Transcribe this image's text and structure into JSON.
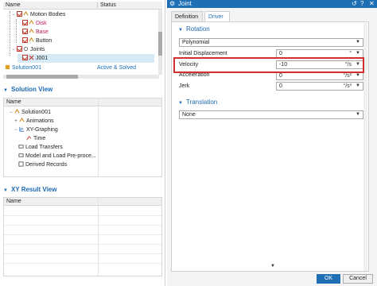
{
  "navigator": {
    "col_name": "Name",
    "col_status": "Status",
    "items": [
      {
        "label": "Motion Bodies"
      },
      {
        "label": "Disk"
      },
      {
        "label": "Base"
      },
      {
        "label": "Button"
      },
      {
        "label": "Joints"
      },
      {
        "label": "J001"
      },
      {
        "label": "Solution001",
        "status": "Active & Solved"
      }
    ]
  },
  "solution_view": {
    "title": "Solution View",
    "col_name": "Name",
    "items": [
      {
        "label": "Solution001"
      },
      {
        "label": "Animations"
      },
      {
        "label": "XY-Graphing"
      },
      {
        "label": "Time"
      },
      {
        "label": "Load Transfers"
      },
      {
        "label": "Model and Load Pre-proce..."
      },
      {
        "label": "Derived Records"
      }
    ]
  },
  "xy_view": {
    "title": "XY Result View",
    "col_name": "Name"
  },
  "dialog": {
    "title": "Joint",
    "tabs": [
      {
        "label": "Definition"
      },
      {
        "label": "Driver"
      }
    ],
    "rotation": {
      "title": "Rotation",
      "type_value": "Polynomial",
      "fields": [
        {
          "label": "Initial Displacement",
          "value": "0",
          "unit": "°"
        },
        {
          "label": "Velocity",
          "value": "-10",
          "unit": "°/s"
        },
        {
          "label": "Acceleration",
          "value": "0",
          "unit": "°/s²"
        },
        {
          "label": "Jerk",
          "value": "0",
          "unit": "°/s³"
        }
      ]
    },
    "translation": {
      "title": "Translation",
      "type_value": "None"
    },
    "ok_label": "OK",
    "cancel_label": "Cancel",
    "colors": {
      "accent": "#1f6fb5",
      "highlight": "#d32f2f"
    }
  }
}
